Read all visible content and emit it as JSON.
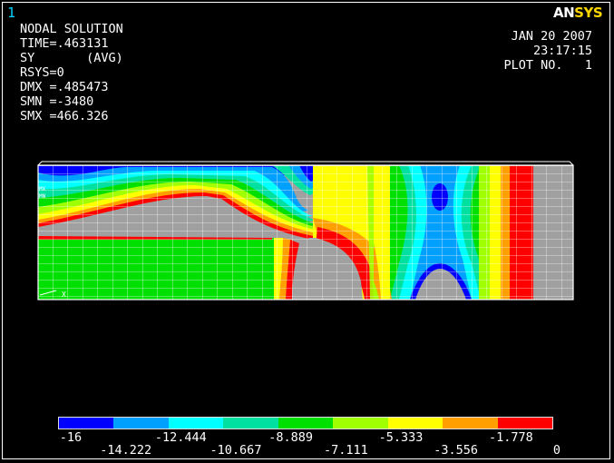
{
  "window_number": "1",
  "logo": {
    "part1": "AN",
    "part2": "SYS"
  },
  "info": {
    "title": "NODAL SOLUTION",
    "time": "TIME=.463131",
    "component": "SY       (AVG)",
    "rsys": "RSYS=0",
    "dmx": "DMX =.485473",
    "smn": "SMN =-3480",
    "smx": "SMX =466.326"
  },
  "stamp": {
    "date": "JAN 20 2007",
    "time": "23:17:15",
    "plot": "PLOT NO.   1"
  },
  "model_labels": {
    "mx": "MX",
    "mn": "MN",
    "x": "X"
  },
  "legend": {
    "colors": [
      "#0000ff",
      "#00a0ff",
      "#00ffff",
      "#00e0a0",
      "#00e000",
      "#a0ff00",
      "#ffff00",
      "#ffa000",
      "#ff0000"
    ],
    "labels_top": [
      "-16",
      "-12.444",
      "-8.889",
      "-5.333",
      "-1.778"
    ],
    "labels_bottom": [
      "-14.222",
      "-10.667",
      "-7.111",
      "-3.556",
      "0"
    ]
  }
}
